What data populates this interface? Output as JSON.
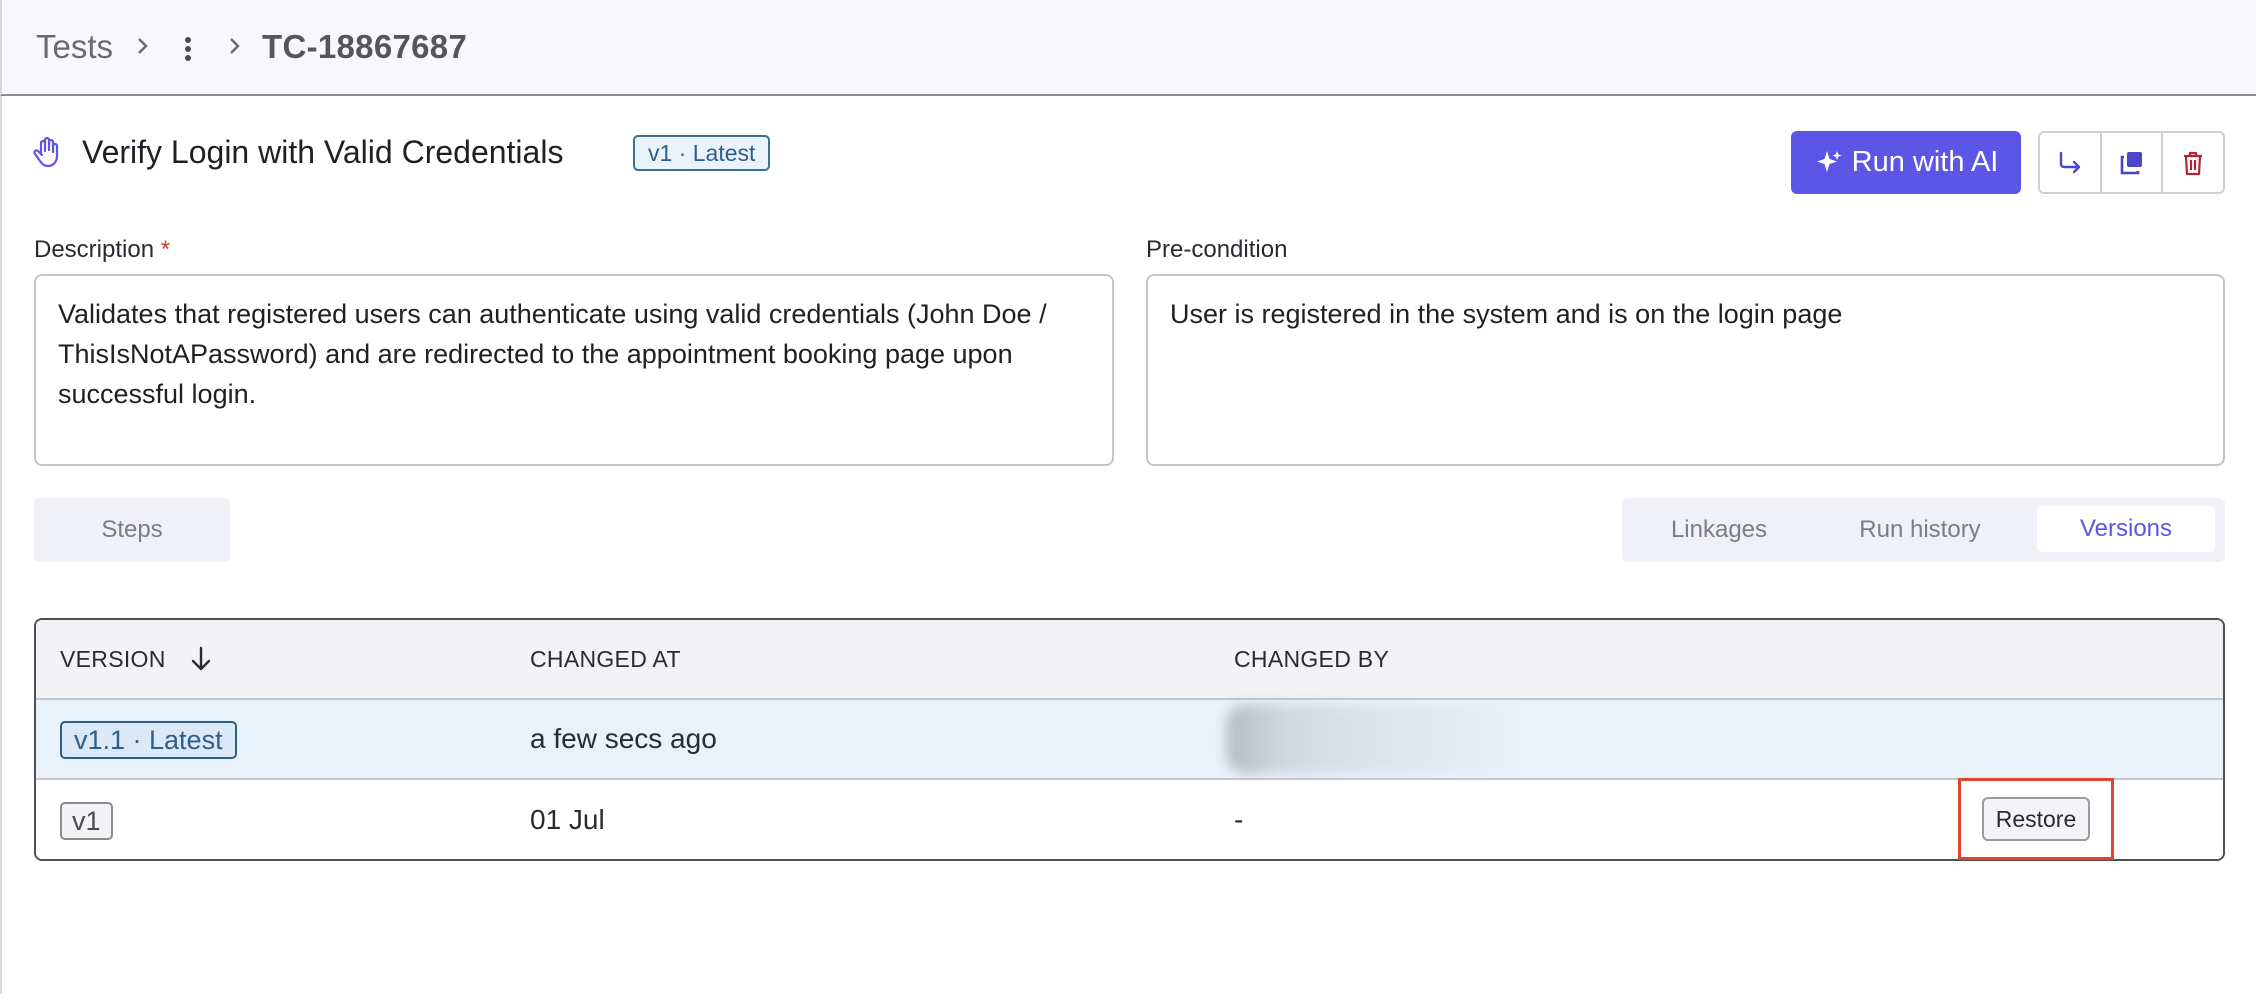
{
  "breadcrumb": {
    "root": "Tests",
    "current": "TC-18867687"
  },
  "test": {
    "title": "Verify Login with Valid Credentials",
    "version_badge": "v1 · Latest"
  },
  "actions": {
    "run_ai_label": "Run with AI"
  },
  "description": {
    "label": "Description",
    "required_mark": "*",
    "value": "Validates that registered users can authenticate using valid credentials (John Doe / ThisIsNotAPassword) and are redirected to the appointment booking page upon successful login."
  },
  "precondition": {
    "label": "Pre-condition",
    "value": "User is registered in the system and is on the login page"
  },
  "tabs": {
    "steps": "Steps",
    "right": [
      {
        "label": "Linkages",
        "active": false
      },
      {
        "label": "Run history",
        "active": false
      },
      {
        "label": "Versions",
        "active": true
      }
    ]
  },
  "versions_table": {
    "columns": [
      "VERSION",
      "CHANGED AT",
      "CHANGED BY"
    ],
    "rows": [
      {
        "version": "v1.1 · Latest",
        "changed_at": "a few secs ago",
        "changed_by": ""
      },
      {
        "version": "v1",
        "changed_at": "01 Jul",
        "changed_by": "-",
        "action": "Restore"
      }
    ]
  },
  "colors": {
    "accent": "#5b56e6",
    "danger": "#b0243a",
    "highlight": "#e0452f"
  }
}
